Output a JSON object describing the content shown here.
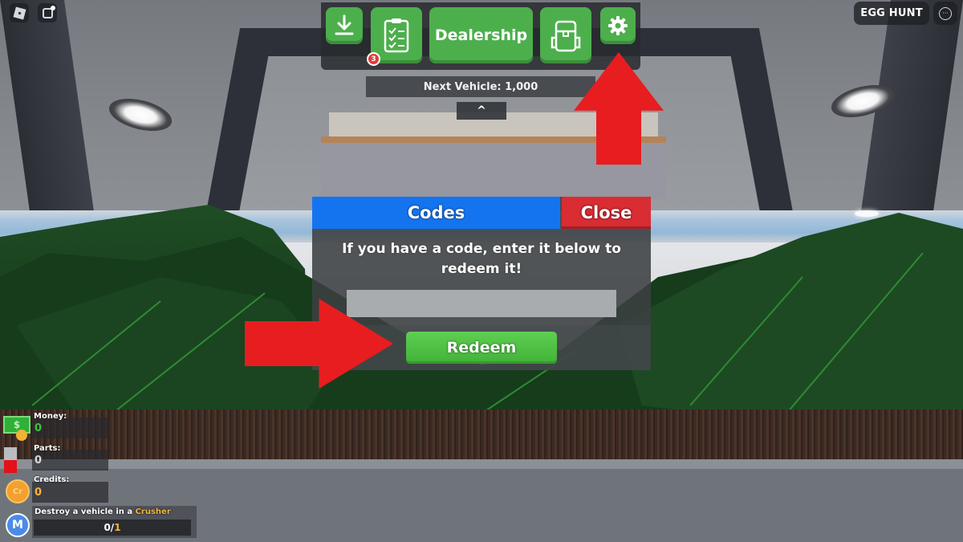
{
  "top_left": {
    "roblox_menu_icon": "roblox-logo-icon",
    "chat_icon": "chat-icon"
  },
  "top_right": {
    "event_label": "EGG HUNT",
    "more_icon": "ellipsis-icon",
    "more_glyph": "···"
  },
  "toolbar": {
    "download_icon": "download-icon",
    "quests_icon": "clipboard-checklist-icon",
    "quests_badge": "3",
    "dealership_label": "Dealership",
    "backpack_icon": "backpack-icon",
    "settings_icon": "gear-icon",
    "next_vehicle": "Next Vehicle: 1,000",
    "collapse_glyph": "^"
  },
  "codes_dialog": {
    "title": "Codes",
    "close_label": "Close",
    "instruction": "If you have a code, enter it below to redeem it!",
    "code_input_value": "",
    "code_input_placeholder": "",
    "redeem_label": "Redeem"
  },
  "stats": [
    {
      "label": "Money:",
      "value": "0",
      "icon": "money-icon",
      "color": "#3cc43c"
    },
    {
      "label": "Parts:",
      "value": "0",
      "icon": "parts-icon",
      "color": "#d9d9d9"
    },
    {
      "label": "Credits:",
      "value": "0",
      "icon": "credits-icon",
      "color": "#f5b53d"
    }
  ],
  "stat_icon_text": {
    "money": "$",
    "credits": "Cr",
    "mission": "M"
  },
  "mission": {
    "text_prefix": "Destroy a vehicle in a ",
    "text_highlight": "Crusher",
    "progress_current": "0",
    "progress_sep": "/",
    "progress_total": "1"
  },
  "annotations": {
    "arrow_up_target": "settings",
    "arrow_right_target": "redeem",
    "arrow_color": "#e81d20"
  },
  "colors": {
    "toolbar_green": "#4caf4c",
    "codes_blue": "#1474f0",
    "close_red": "#d92c33",
    "redeem_green": "#4cbf42"
  }
}
